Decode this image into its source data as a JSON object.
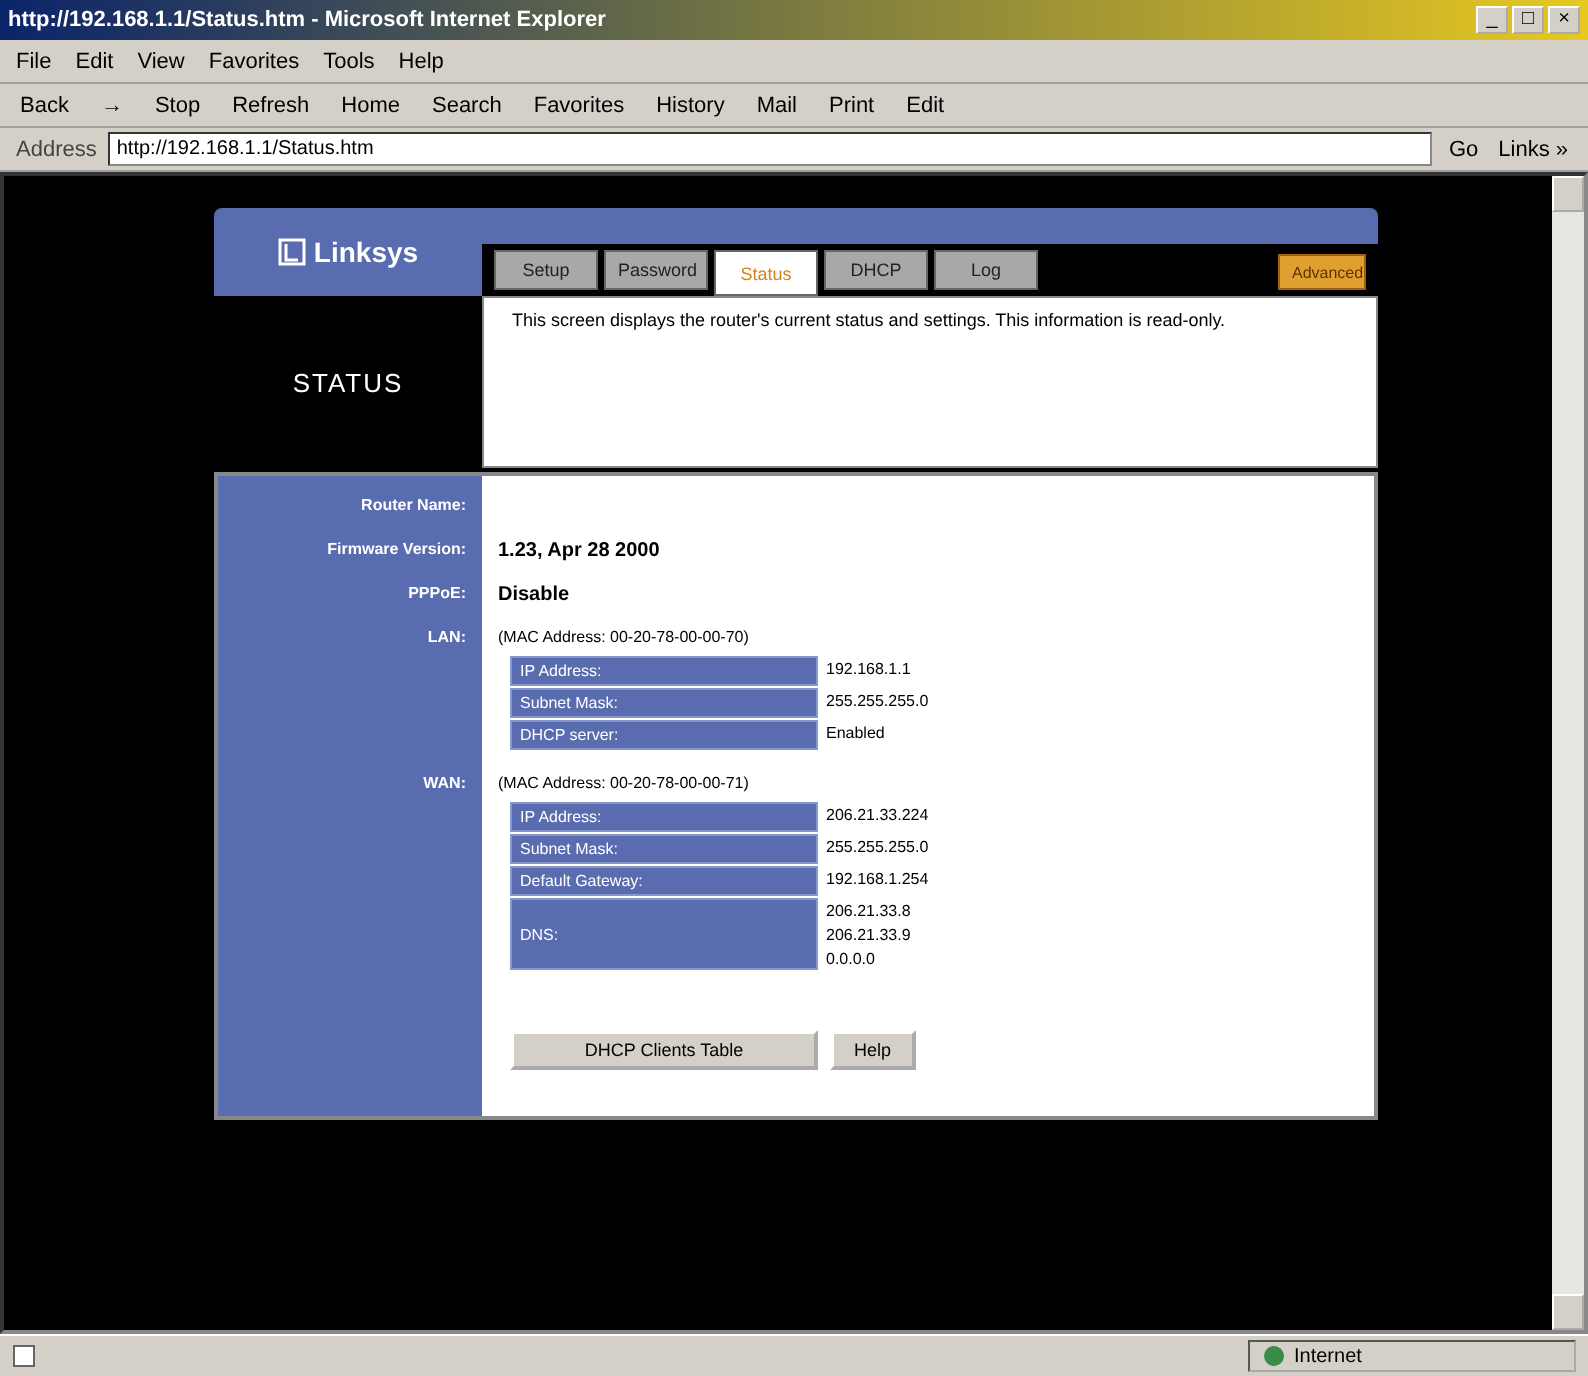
{
  "window": {
    "title": "http://192.168.1.1/Status.htm - Microsoft Internet Explorer",
    "controls": [
      "_",
      "□",
      "×"
    ]
  },
  "menu": [
    "File",
    "Edit",
    "View",
    "Favorites",
    "Tools",
    "Help"
  ],
  "toolbar": [
    {
      "label": "Back"
    },
    {
      "label": "→"
    },
    {
      "label": "Stop"
    },
    {
      "label": "Refresh"
    },
    {
      "label": "Home"
    },
    {
      "label": "Search"
    },
    {
      "label": "Favorites"
    },
    {
      "label": "History"
    },
    {
      "label": "Mail"
    },
    {
      "label": "Print"
    },
    {
      "label": "Edit"
    }
  ],
  "address": {
    "label": "Address",
    "value": "http://192.168.1.1/Status.htm",
    "go": "Go",
    "links": "Links »"
  },
  "router": {
    "logo": "Linksys",
    "section": "STATUS",
    "tabs": [
      {
        "label": "Setup",
        "selected": false
      },
      {
        "label": "Password",
        "selected": false
      },
      {
        "label": "Status",
        "selected": true
      },
      {
        "label": "DHCP",
        "selected": false
      },
      {
        "label": "Log",
        "selected": false
      }
    ],
    "advanced": "Advanced",
    "description": "This screen displays the router's current status and settings. This information is read-only.",
    "fields": [
      {
        "label": "Router Name:"
      },
      {
        "label": "Firmware Version:",
        "value": "1.23, Apr 28 2000"
      },
      {
        "label": "PPPoE:",
        "value": "Disable"
      }
    ],
    "groups": [
      {
        "label": "LAN:",
        "mac": "(MAC Address: 00-20-78-00-00-70)",
        "rows": [
          {
            "label": "IP Address:",
            "values": [
              "192.168.1.1"
            ]
          },
          {
            "label": "Subnet Mask:",
            "values": [
              "255.255.255.0"
            ]
          },
          {
            "label": "DHCP server:",
            "values": [
              "Enabled"
            ]
          }
        ]
      },
      {
        "label": "WAN:",
        "mac": "(MAC Address: 00-20-78-00-00-71)",
        "rows": [
          {
            "label": "IP Address:",
            "values": [
              "206.21.33.224"
            ]
          },
          {
            "label": "Subnet Mask:",
            "values": [
              "255.255.255.0"
            ]
          },
          {
            "label": "Default Gateway:",
            "values": [
              "192.168.1.254"
            ]
          },
          {
            "label": "DNS:",
            "values": [
              "206.21.33.8",
              "206.21.33.9",
              "0.0.0.0"
            ]
          }
        ]
      }
    ],
    "buttons": [
      "DHCP Clients Table",
      "Help"
    ]
  },
  "status_bar": {
    "zone": "Internet"
  }
}
